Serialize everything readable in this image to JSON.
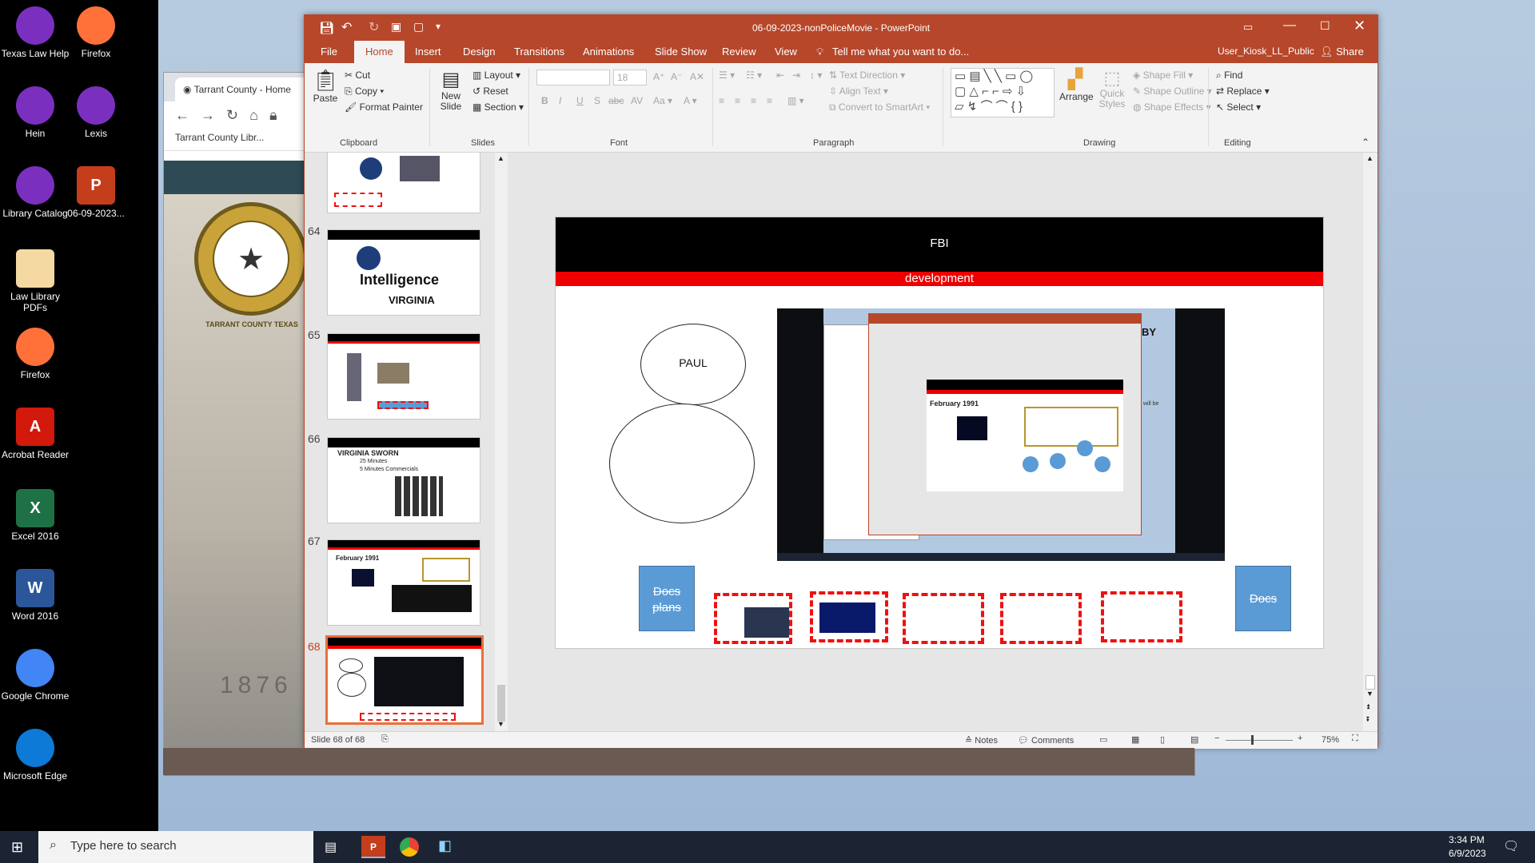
{
  "desktop": {
    "icons": [
      {
        "label": "Texas Law Help",
        "icon": "firefox-icon",
        "color": "#7b2fbf"
      },
      {
        "label": "Firefox",
        "icon": "firefox-icon",
        "color": "#ff7139"
      },
      {
        "label": "Hein",
        "icon": "firefox-icon",
        "color": "#7b2fbf"
      },
      {
        "label": "Lexis",
        "icon": "firefox-icon",
        "color": "#7b2fbf"
      },
      {
        "label": "Library Catalog",
        "icon": "firefox-icon",
        "color": "#7b2fbf"
      },
      {
        "label": "06-09-2023...",
        "icon": "powerpoint-file-icon",
        "color": "#c43e1c"
      },
      {
        "label": "Law Library PDFs",
        "icon": "pdf-folder-icon",
        "color": "#f4d9a2"
      },
      {
        "label": "Firefox",
        "icon": "firefox-icon",
        "color": "#ff7139"
      },
      {
        "label": "Acrobat Reader",
        "icon": "acrobat-icon",
        "color": "#d2190b"
      },
      {
        "label": "Excel 2016",
        "icon": "excel-icon",
        "color": "#1e7145"
      },
      {
        "label": "Word 2016",
        "icon": "word-icon",
        "color": "#2b579a"
      },
      {
        "label": "Google Chrome",
        "icon": "chrome-icon",
        "color": "#4285f4"
      },
      {
        "label": "Microsoft Edge",
        "icon": "edge-icon",
        "color": "#0c7ad6"
      }
    ]
  },
  "browser": {
    "tab_title": "Tarrant County - Home",
    "bookmark": "Tarrant County Libr...",
    "seal_text": "TARRANT COUNTY TEXAS",
    "year_text": "1876"
  },
  "ppt": {
    "window_title": "06-09-2023-nonPoliceMovie - PowerPoint",
    "menu_tabs": [
      "File",
      "Home",
      "Insert",
      "Design",
      "Transitions",
      "Animations",
      "Slide Show",
      "Review",
      "View"
    ],
    "tell_me": "Tell me what you want to do...",
    "user": "User_Kiosk_LL_Public",
    "share": "Share",
    "clipboard": {
      "paste": "Paste",
      "cut": "Cut",
      "copy": "Copy",
      "format_painter": "Format Painter",
      "label": "Clipboard"
    },
    "slides_group": {
      "new_slide": "New Slide",
      "layout": "Layout",
      "reset": "Reset",
      "section": "Section",
      "label": "Slides"
    },
    "font_group": {
      "font_size": "18",
      "label": "Font"
    },
    "paragraph_group": {
      "text_direction": "Text Direction",
      "align_text": "Align Text",
      "smartart": "Convert to SmartArt",
      "label": "Paragraph"
    },
    "drawing_group": {
      "arrange": "Arrange",
      "quick_styles": "Quick Styles",
      "shape_fill": "Shape Fill",
      "shape_outline": "Shape Outline",
      "shape_effects": "Shape Effects",
      "label": "Drawing"
    },
    "editing_group": {
      "find": "Find",
      "replace": "Replace",
      "select": "Select",
      "label": "Editing"
    },
    "thumbnails": [
      {
        "num": "64",
        "big_text": "Intelligence",
        "sub_text": "VIRGINIA"
      },
      {
        "num": "65"
      },
      {
        "num": "66",
        "big_text": "VIRGINIA SWORN",
        "sub_text": "25 Minutes",
        "sub_text2": "5 Minutes Commercials"
      },
      {
        "num": "67",
        "big_text": "February 1991"
      },
      {
        "num": "68"
      }
    ],
    "slide": {
      "header": "FBI",
      "subheader": "development",
      "circle_label": "PAUL",
      "cube_left": "Docs plans",
      "cube_right": "Docs",
      "inner_title_fragment": "BY",
      "inner_slide_date": "February 1991",
      "inner_right_text": "will be"
    },
    "status": {
      "slide_counter": "Slide 68 of 68",
      "notes": "Notes",
      "comments": "Comments",
      "zoom": "75%"
    }
  },
  "taskbar": {
    "search_placeholder": "Type here to search",
    "time": "3:34 PM",
    "date": "6/9/2023"
  }
}
